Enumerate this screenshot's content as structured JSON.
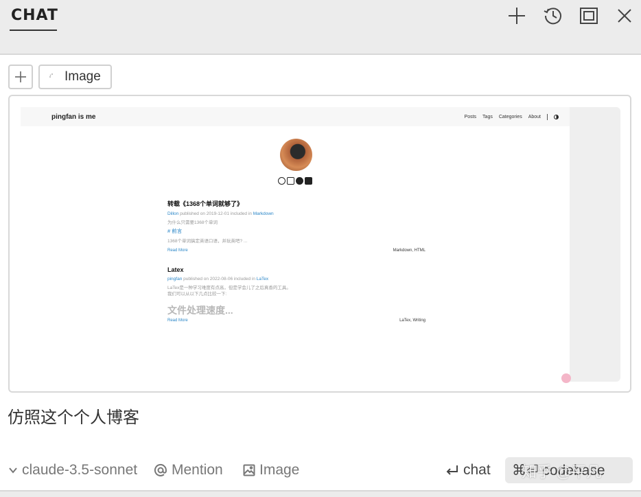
{
  "header": {
    "tab_label": "CHAT",
    "icons": [
      "plus-icon",
      "history-icon",
      "maximize-icon",
      "close-icon"
    ]
  },
  "attachments": {
    "image_chip_label": "Image"
  },
  "preview": {
    "site_title": "pingfan is me",
    "nav": [
      "Posts",
      "Tags",
      "Categories",
      "About"
    ],
    "posts": [
      {
        "title": "转载《1368个单词就够了》",
        "author": "Dillon",
        "meta_middle": " published on 2019-12-01 included in ",
        "category": "Markdown",
        "lines": [
          "为什么只需要1368个单词"
        ],
        "heading": "# 前言",
        "excerpt": "1368个单词搞定英语口语，并玩英吧? ...",
        "read_more": "Read More",
        "tags": "Markdown, HTML"
      },
      {
        "title": "Latex",
        "author": "pingfan",
        "meta_middle": " published on 2022-08-06 included in ",
        "category": "LaTex",
        "lines": [
          "LaTex是一种学习难度有点高，但是学会儿了之后真香的工具。",
          "我们可以从以下几点比较一下:"
        ],
        "big_text": "文件处理速度...",
        "read_more": "Read More",
        "tags": "LaTex, Writing"
      }
    ]
  },
  "prompt_text": "仿照这个个人博客",
  "footer": {
    "model": "claude-3.5-sonnet",
    "mention": "Mention",
    "image": "Image",
    "chat": "chat",
    "codebase": "⌘⏎ codebase",
    "watermark": "知乎 @平凡"
  },
  "colors": {
    "link": "#2a86c7",
    "background": "#ececec",
    "panel": "#ffffff"
  }
}
